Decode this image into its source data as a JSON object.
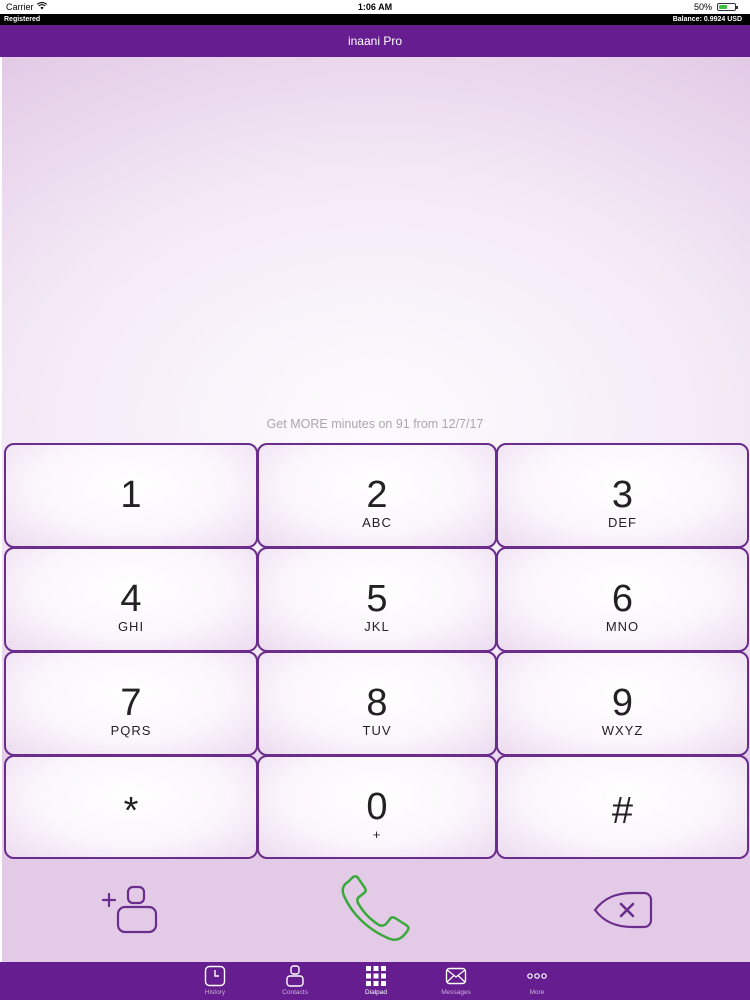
{
  "status_bar": {
    "carrier": "Carrier",
    "time": "1:06 AM",
    "battery": "50%"
  },
  "info_bar": {
    "registration": "Registered",
    "balance": "Balance: 0.9924 USD"
  },
  "nav": {
    "title": "inaani Pro"
  },
  "promo": "Get MORE minutes on 91 from 12/7/17",
  "keypad": [
    {
      "digit": "1",
      "letters": ""
    },
    {
      "digit": "2",
      "letters": "ABC"
    },
    {
      "digit": "3",
      "letters": "DEF"
    },
    {
      "digit": "4",
      "letters": "GHI"
    },
    {
      "digit": "5",
      "letters": "JKL"
    },
    {
      "digit": "6",
      "letters": "MNO"
    },
    {
      "digit": "7",
      "letters": "PQRS"
    },
    {
      "digit": "8",
      "letters": "TUV"
    },
    {
      "digit": "9",
      "letters": "WXYZ"
    },
    {
      "digit": "*",
      "letters": ""
    },
    {
      "digit": "0",
      "letters": "+"
    },
    {
      "digit": "#",
      "letters": ""
    }
  ],
  "actions": {
    "add_contact_icon": "add-contact-icon",
    "call_icon": "phone-icon",
    "delete_icon": "backspace-icon"
  },
  "tabs": [
    {
      "label": "History",
      "icon": "clock-icon"
    },
    {
      "label": "Contacts",
      "icon": "contact-icon"
    },
    {
      "label": "Dialpad",
      "icon": "dialpad-icon",
      "active": true
    },
    {
      "label": "Messages",
      "icon": "envelope-icon"
    },
    {
      "label": "More",
      "icon": "more-icon"
    }
  ],
  "colors": {
    "brand_purple": "#651d8f",
    "key_border": "#6a2d8c",
    "call_green": "#3aa83a",
    "battery_green": "#3fbf3f"
  }
}
